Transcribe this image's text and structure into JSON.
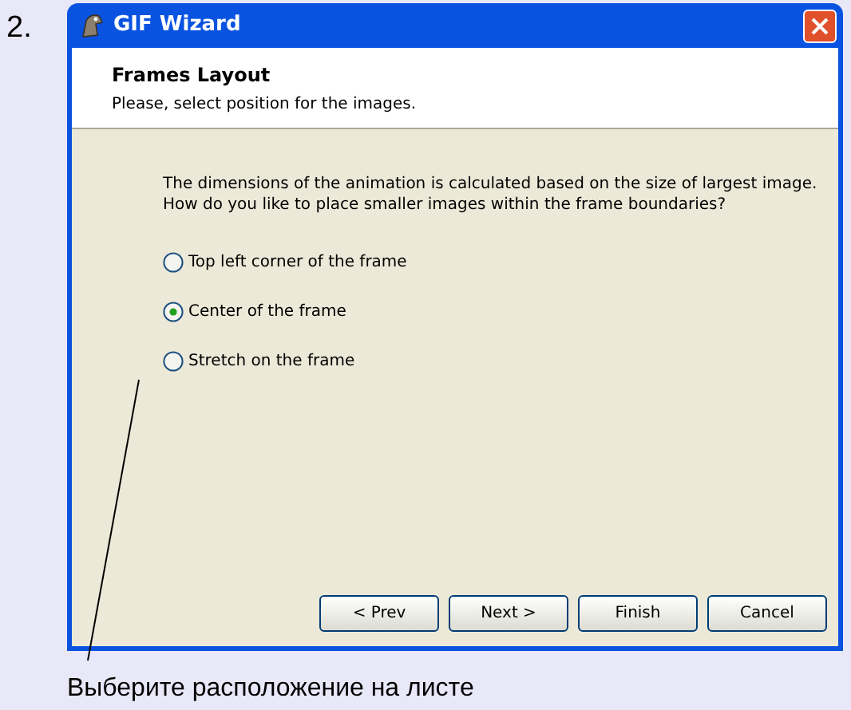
{
  "step_number": "2.",
  "window": {
    "title": "GIF Wizard"
  },
  "header": {
    "title": "Frames Layout",
    "subtitle": "Please, select position for the images."
  },
  "description": [
    "The dimensions of the animation is calculated based on the size of largest image.",
    "How do you like to place smaller images within the frame boundaries?"
  ],
  "options": [
    {
      "label": "Top left corner of the frame",
      "selected": false
    },
    {
      "label": "Center of the frame",
      "selected": true
    },
    {
      "label": "Stretch on the frame",
      "selected": false
    }
  ],
  "buttons": [
    "< Prev",
    "Next >",
    "Finish",
    "Cancel"
  ],
  "caption": "Выберите расположение на листе"
}
